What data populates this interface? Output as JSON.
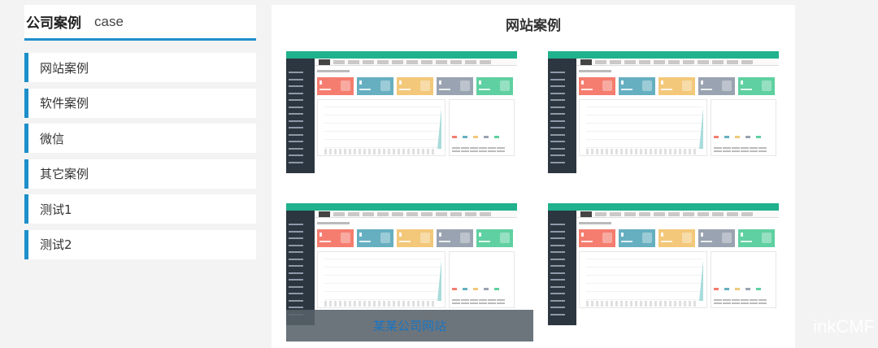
{
  "sidebar": {
    "title": "公司案例",
    "subtitle": "case",
    "items": [
      {
        "label": "网站案例"
      },
      {
        "label": "软件案例"
      },
      {
        "label": "微信"
      },
      {
        "label": "其它案例"
      },
      {
        "label": "测试1"
      },
      {
        "label": "测试2"
      }
    ]
  },
  "main": {
    "title": "网站案例",
    "cases": [
      {
        "id": "case-1"
      },
      {
        "id": "case-2"
      },
      {
        "id": "case-3"
      },
      {
        "id": "case-4"
      }
    ],
    "overlay_caption": "某某公司网站"
  },
  "watermark": "inkCMF",
  "colors": {
    "accent": "#1e8fc9",
    "thumb_topbar": "#20b28c",
    "thumb_sidebar": "#2b3641",
    "card_red": "#f57d6f",
    "card_teal": "#66afc1",
    "card_yellow": "#f3c87a",
    "card_gray": "#9aa3b1",
    "card_green": "#5fd0a1"
  }
}
